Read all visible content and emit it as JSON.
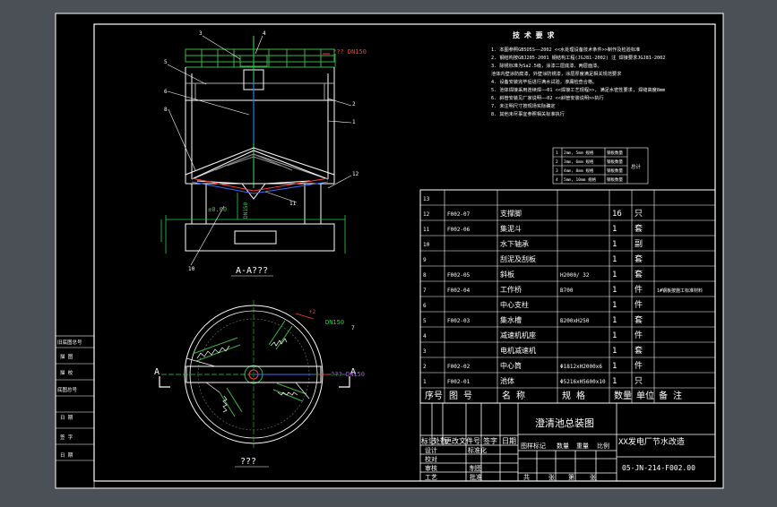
{
  "colors": {
    "background": "#4a5056",
    "paper": "#000000",
    "line": "#ffffff",
    "structure_green": "#3ab54a",
    "dimension_green": "#2ecc40",
    "annotation_red": "#ff3b3b",
    "accent_blue": "#3b6cff",
    "accent_purple": "#b64bff"
  },
  "section_view": {
    "caption": "A-A???",
    "level_mark": "±0.00",
    "pipe_top": "??? DN150",
    "pipe_side": "DN150",
    "callouts": [
      "3",
      "4",
      "5",
      "6",
      "8",
      "2",
      "1",
      "12",
      "10",
      "11"
    ]
  },
  "plan_view": {
    "caption": "???",
    "section_letters": [
      "A",
      "A"
    ],
    "level": "+2",
    "pipe_top": "DN150",
    "pipe_right": "??? DN150",
    "callout": "7"
  },
  "tech_notes": {
    "title": "技 术 要 求",
    "lines": [
      "1. 本图参照GB5O5S——2002    <<水处理设备技术条件>>制作及检验标准",
      "2. 钢结构按GBJ205-2001    钢结构工程(JGJ81-2002)     注 焊接要求JGJ81-2002",
      "3. 除锈标准为Sa2.5级，涂漆二层底漆、两层面漆。",
      "   池体内壁涂防腐漆，外壁涂防锈漆，涂层厚度满足相关规范要求",
      "4. 设备安装完毕后进行满水试验，渗漏检查合格。",
      "5. 池体焊接采用连续焊——01      <<焊接工艺规程>>, 满足水密性要求, 焊缝高度8mm",
      "6. 斜管安装见厂家说明——02      <<斜管安装说明>>执行",
      "7. 未注明尺寸按现场实际确定",
      "8. 其他未尽事宜参照相关标准执行"
    ]
  },
  "mini_table": {
    "rows": [
      [
        "1",
        "2mm, 5mm 规格",
        "钢板数量"
      ],
      [
        "2",
        "3mm, 6mm 规格",
        "钢板数量"
      ],
      [
        "3",
        "4mm, 8mm 规格",
        "钢板数量"
      ],
      [
        "4",
        "5mm, 10mm 规格",
        "钢板数量"
      ]
    ],
    "side_label": "总计"
  },
  "bom": {
    "rows": [
      {
        "no": "13",
        "code": "",
        "name": "",
        "spec": "",
        "qty": "",
        "unit": "",
        "remark": ""
      },
      {
        "no": "12",
        "code": "F002-07",
        "name": "支撑脚",
        "spec": "",
        "qty": "16",
        "unit": "只",
        "remark": ""
      },
      {
        "no": "11",
        "code": "F002-06",
        "name": "集泥斗",
        "spec": "",
        "qty": "1",
        "unit": "套",
        "remark": ""
      },
      {
        "no": "10",
        "code": "",
        "name": "水下轴承",
        "spec": "",
        "qty": "1",
        "unit": "副",
        "remark": ""
      },
      {
        "no": "9",
        "code": "",
        "name": "刮泥及刮板",
        "spec": "",
        "qty": "1",
        "unit": "套",
        "remark": ""
      },
      {
        "no": "8",
        "code": "F002-05",
        "name": "斜板",
        "spec": "H2000/ 32",
        "qty": "1",
        "unit": "套",
        "remark": ""
      },
      {
        "no": "7",
        "code": "F002-04",
        "name": "工作桥",
        "spec": "B700",
        "qty": "1",
        "unit": "件",
        "remark": "1#钢板按施工标准材料"
      },
      {
        "no": "6",
        "code": "",
        "name": "中心支柱",
        "spec": "",
        "qty": "1",
        "unit": "件",
        "remark": ""
      },
      {
        "no": "5",
        "code": "F002-03",
        "name": "集水槽",
        "spec": "B200xH250",
        "qty": "1",
        "unit": "套",
        "remark": ""
      },
      {
        "no": "4",
        "code": "",
        "name": "减速机机座",
        "spec": "",
        "qty": "1",
        "unit": "件",
        "remark": ""
      },
      {
        "no": "3",
        "code": "",
        "name": "电机减速机",
        "spec": "",
        "qty": "1",
        "unit": "套",
        "remark": ""
      },
      {
        "no": "2",
        "code": "F002-02",
        "name": "中心筒",
        "spec": "Φ1812xH2000x6",
        "qty": "1",
        "unit": "件",
        "remark": ""
      },
      {
        "no": "1",
        "code": "F002-01",
        "name": "池体",
        "spec": "Φ5216xH5600x10",
        "qty": "1",
        "unit": "只",
        "remark": ""
      }
    ],
    "header": {
      "no": "序号",
      "code": "图 号",
      "name": "名 称",
      "spec": "规 格",
      "qty": "数量",
      "unit": "单位",
      "remark": "备 注"
    }
  },
  "title_block": {
    "drawing_title": "澄清池总装图",
    "project": "XX发电厂节水改造",
    "drawing_no": "05-JN-214-F002.00",
    "rev_labels": [
      "标记",
      "处数",
      "更改文件号",
      "签字",
      "日期"
    ],
    "role_labels": [
      "设计",
      "校对",
      "审核",
      "工艺"
    ],
    "side_labels": [
      "标准化",
      "制图",
      "批准"
    ],
    "scale_labels": [
      "图样标记",
      "数量",
      "重量",
      "比例"
    ],
    "sheet_labels": [
      "共",
      "张",
      "第",
      "张"
    ]
  },
  "left_strip": {
    "labels": [
      "旧底图总号",
      "描 图",
      "底图总号",
      "描 校",
      "日 期",
      "签 字",
      "日 期"
    ]
  }
}
